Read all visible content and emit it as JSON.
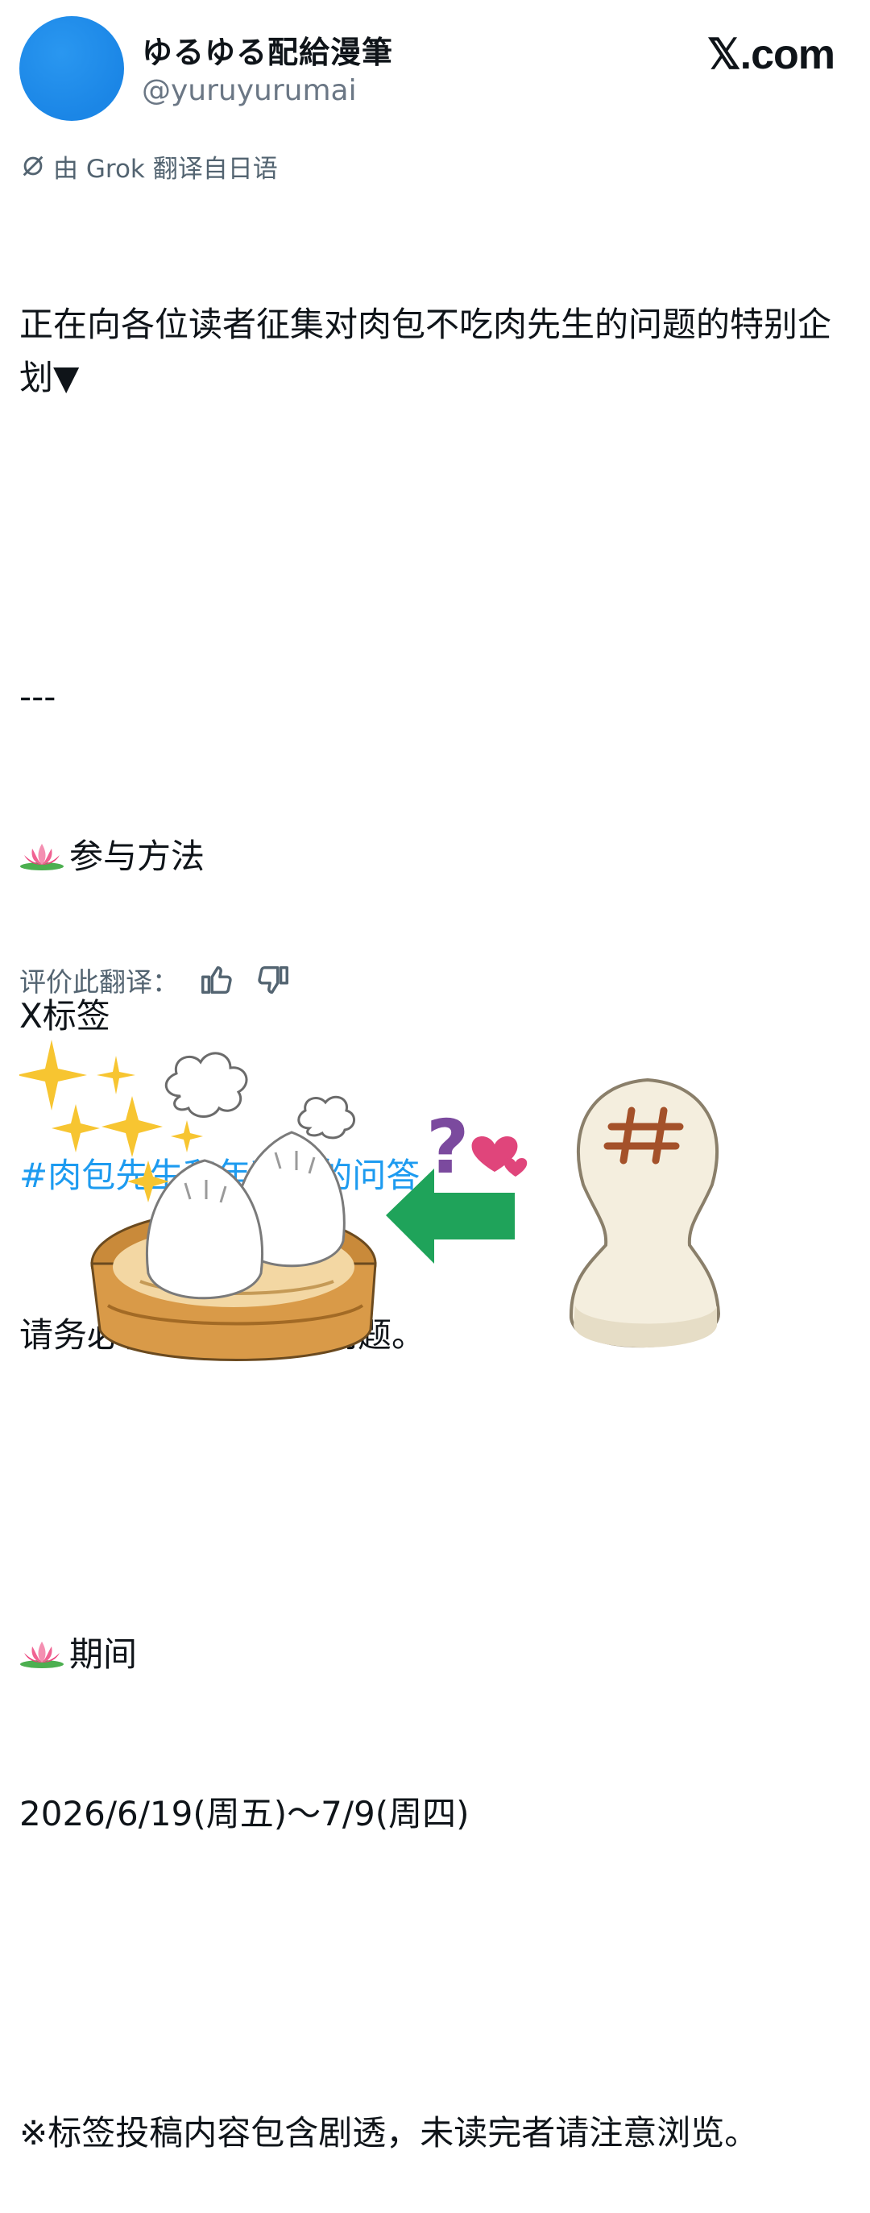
{
  "author": {
    "display_name": "ゆるゆる配給漫筆",
    "handle": "@yuruyurumai"
  },
  "brand": "𝕏.com",
  "translation_notice": "由 Grok 翻译自日语",
  "post": {
    "paragraphs": [
      "正在向各位读者征集对肉包不吃肉先生的问题的特别企划▼",
      "---",
      "参与方法",
      "X标签",
      "#肉包先生和年糕精的问答",
      "请务必在此提交大量问题。",
      "期间",
      "2026/6/19(周五)～7/9(周四)",
      "※标签投稿内容包含剧透，未读完者请注意浏览。"
    ]
  },
  "rate_translation_label": "评价此翻译：",
  "icons": {
    "translate": "grok-translate-icon",
    "thumbs_up": "thumbs-up-icon",
    "thumbs_down": "thumbs-down-icon",
    "lotus": "lotus-emoji-icon"
  },
  "colors": {
    "avatar": "#1b86e6",
    "hashtag": "#1d9bf0",
    "muted": "#536471",
    "arrow": "#1fa35a",
    "steamer": "#c98a3a",
    "heart": "#e0457b",
    "question": "#7b4a9e"
  }
}
